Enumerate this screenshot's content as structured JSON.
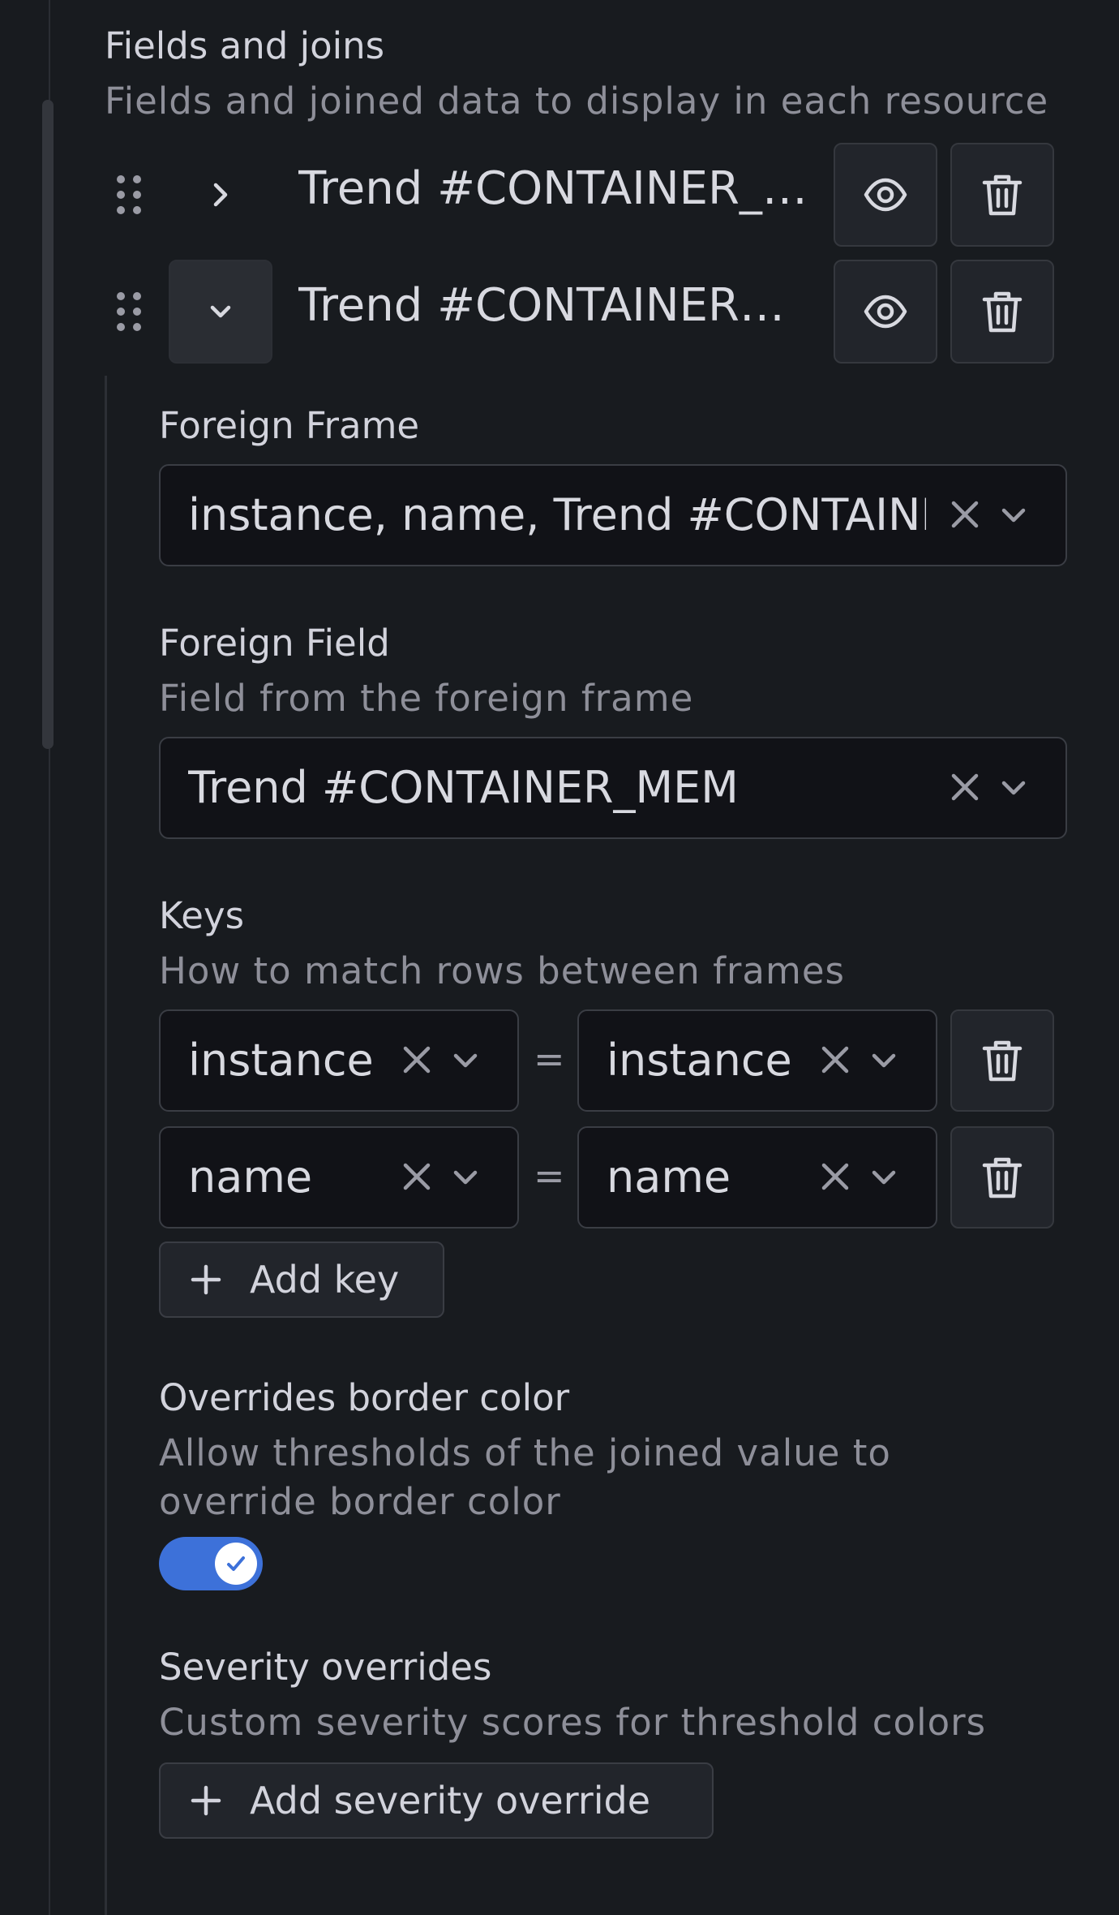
{
  "section": {
    "title": "Fields and joins",
    "description": "Fields and joined data to display in each resource"
  },
  "rows": [
    {
      "label": "Trend #CONTAINER_C...",
      "expanded": false
    },
    {
      "label": "Trend #CONTAINER_...",
      "expanded": true
    }
  ],
  "join": {
    "foreign_frame": {
      "title": "Foreign Frame",
      "value": "instance, name, Trend #CONTAINER_MEM"
    },
    "foreign_field": {
      "title": "Foreign Field",
      "description": "Field from the foreign frame",
      "value": "Trend #CONTAINER_MEM"
    },
    "keys": {
      "title": "Keys",
      "description": "How to match rows between frames",
      "pairs": [
        {
          "left": "instance",
          "right": "instance"
        },
        {
          "left": "name",
          "right": "name"
        }
      ],
      "equals": "=",
      "add_label": "Add key"
    },
    "overrides_border": {
      "title": "Overrides border color",
      "description_line1": "Allow thresholds of the joined value to",
      "description_line2": "override border color",
      "enabled": true
    },
    "severity": {
      "title": "Severity overrides",
      "description": "Custom severity scores for threshold colors",
      "add_label": "Add severity override"
    }
  },
  "colors": {
    "background": "#181b1f",
    "accent": "#3d71d9",
    "text": "#d8d9e0",
    "muted": "#8e8f99"
  },
  "icons": [
    "drag-handle-icon",
    "chevron-right-icon",
    "chevron-down-icon",
    "eye-icon",
    "trash-icon",
    "close-icon",
    "plus-icon",
    "check-icon"
  ]
}
